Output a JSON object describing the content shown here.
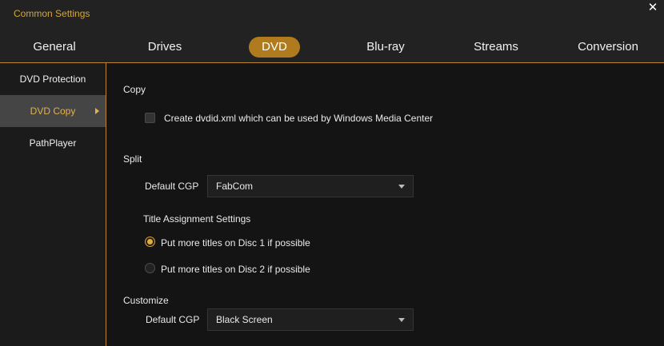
{
  "window": {
    "title": "Common Settings"
  },
  "tabs": [
    {
      "label": "General"
    },
    {
      "label": "Drives"
    },
    {
      "label": "DVD"
    },
    {
      "label": "Blu-ray"
    },
    {
      "label": "Streams"
    },
    {
      "label": "Conversion"
    }
  ],
  "active_tab": "DVD",
  "sidebar": {
    "items": [
      {
        "label": "DVD Protection"
      },
      {
        "label": "DVD Copy"
      },
      {
        "label": "PathPlayer"
      }
    ],
    "active": "DVD Copy"
  },
  "copy": {
    "heading": "Copy",
    "create_dvdid_label": "Create dvdid.xml which can be used by Windows Media Center",
    "create_dvdid_checked": false
  },
  "split": {
    "heading": "Split",
    "default_cgp_label": "Default CGP",
    "default_cgp_value": "FabCom",
    "title_assignment_heading": "Title Assignment Settings",
    "option_disc1": "Put more titles on Disc 1 if possible",
    "option_disc2": "Put more titles on Disc 2 if possible",
    "selected_option": "disc1"
  },
  "customize": {
    "heading": "Customize",
    "default_cgp_label": "Default CGP",
    "default_cgp_value": "Black Screen"
  },
  "colors": {
    "accent": "#b07b1e",
    "accent_text": "#e3b248",
    "background": "#141414"
  }
}
